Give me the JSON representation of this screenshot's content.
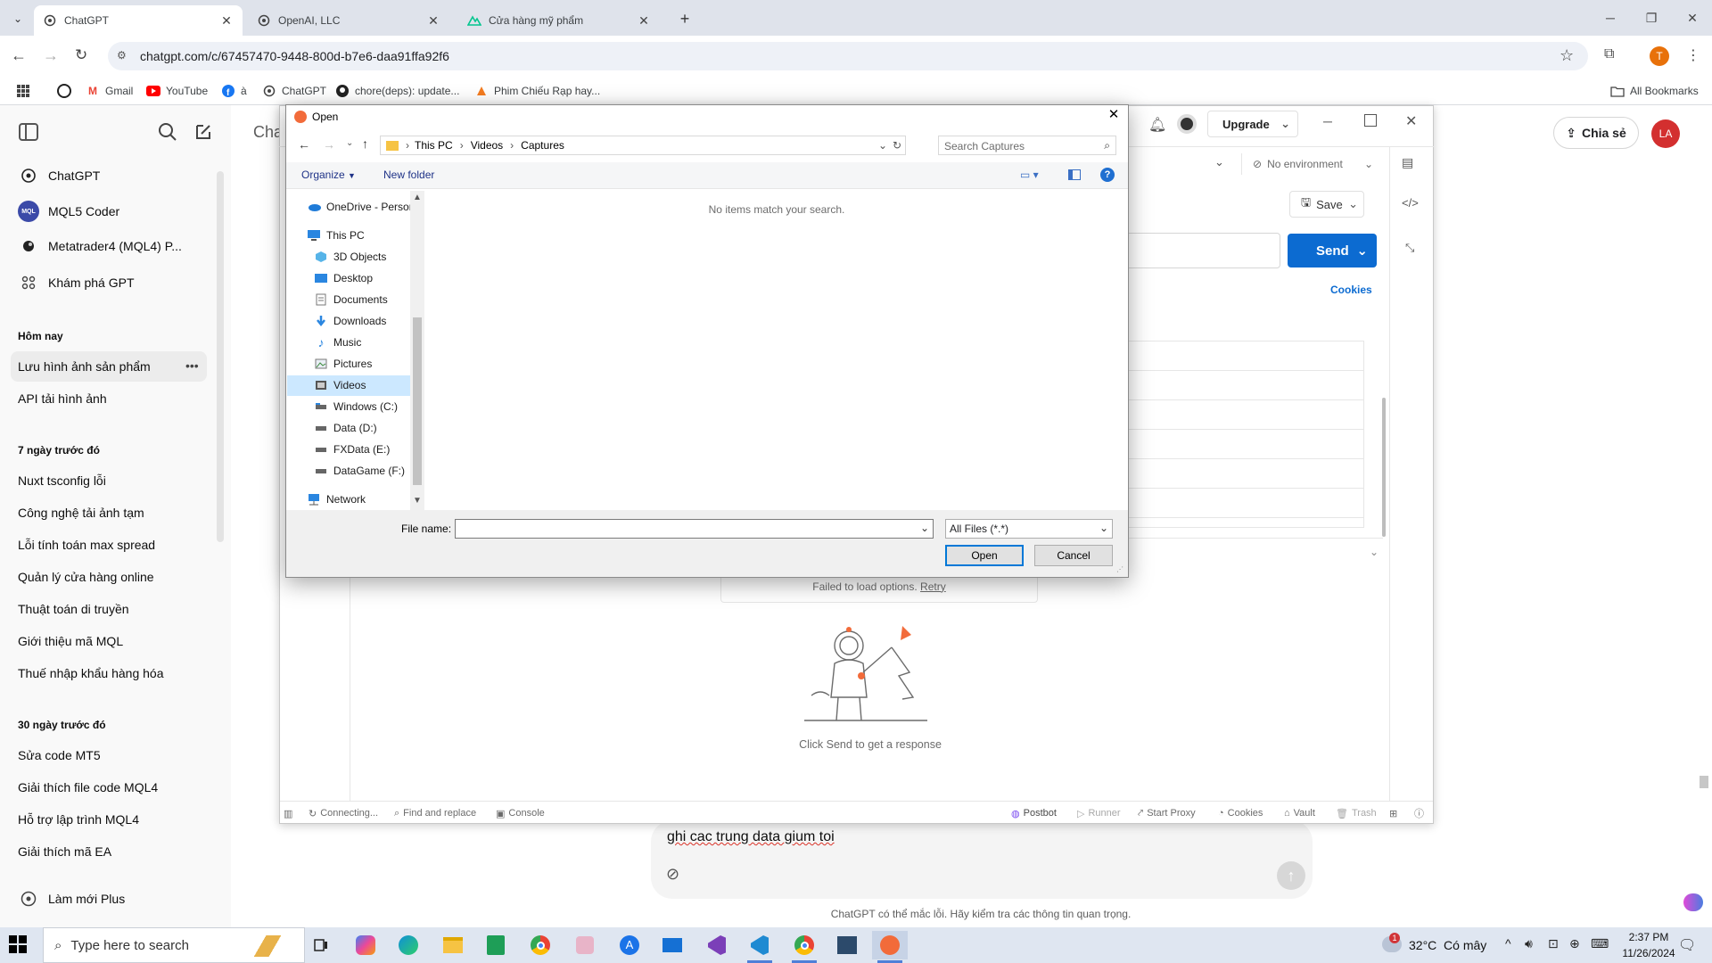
{
  "browser": {
    "tabs": [
      {
        "title": "ChatGPT",
        "active": true
      },
      {
        "title": "OpenAI, LLC",
        "active": false
      },
      {
        "title": "Cửa hàng mỹ phẩm",
        "active": false
      }
    ],
    "url": "chatgpt.com/c/67457470-9448-800d-b7e6-daa91ffa92f6",
    "profile_initial": "T",
    "bookmarks": [
      {
        "label": "Gmail",
        "icon": "gmail-icon"
      },
      {
        "label": "YouTube",
        "icon": "youtube-icon"
      },
      {
        "label": "à",
        "icon": "facebook-icon"
      },
      {
        "label": "ChatGPT",
        "icon": "chatgpt-icon"
      },
      {
        "label": "chore(deps): update...",
        "icon": "github-icon"
      },
      {
        "label": "Phim Chiếu Rạp hay...",
        "icon": "movie-icon"
      }
    ],
    "all_bookmarks": "All Bookmarks"
  },
  "chatgpt": {
    "header_title": "Cha",
    "share_label": "Chia sẻ",
    "avatar": "LA",
    "nav": [
      {
        "label": "ChatGPT",
        "icon": "chatgpt-icon"
      },
      {
        "label": "MQL5 Coder",
        "icon": "mql5-icon"
      },
      {
        "label": "Metatrader4 (MQL4) P...",
        "icon": "metatrader-icon"
      },
      {
        "label": "Khám phá GPT",
        "icon": "grid-icon"
      }
    ],
    "sections": [
      {
        "heading": "Hôm nay",
        "items": [
          "Lưu hình ảnh sản phẩm",
          "API tải hình ảnh"
        ]
      },
      {
        "heading": "7 ngày trước đó",
        "items": [
          "Nuxt tsconfig lỗi",
          "Công nghệ tải ảnh tạm",
          "Lỗi tính toán max spread",
          "Quản lý cửa hàng online",
          "Thuật toán di truyền",
          "Giới thiệu mã MQL",
          "Thuế nhập khẩu hàng hóa"
        ]
      },
      {
        "heading": "30 ngày trước đó",
        "items": [
          "Sửa code MT5",
          "Giải thích file code MQL4",
          "Hỗ trợ lập trình MQL4",
          "Giải thích mã EA"
        ]
      }
    ],
    "upgrade_label": "Làm mới Plus",
    "composer_text": "ghi cac trung data gium toi",
    "disclaimer": "ChatGPT có thể mắc lỗi. Hãy kiểm tra các thông tin quan trọng."
  },
  "postman": {
    "upgrade_label": "Upgrade",
    "environment": "No environment",
    "save_label": "Save",
    "send_label": "Send",
    "cookies_link": "Cookies",
    "failed_text": "Failed to load options.",
    "retry_label": "Retry",
    "empty_caption": "Click Send to get a response",
    "status_left": [
      "Connecting...",
      "Find and replace",
      "Console"
    ],
    "status_right": [
      "Postbot",
      "Runner",
      "Start Proxy",
      "Cookies",
      "Vault",
      "Trash"
    ]
  },
  "dialog": {
    "title": "Open",
    "breadcrumb": [
      "This PC",
      "Videos",
      "Captures"
    ],
    "search_placeholder": "Search Captures",
    "organize_label": "Organize",
    "new_folder_label": "New folder",
    "empty_message": "No items match your search.",
    "tree": [
      {
        "label": "OneDrive - Persor",
        "icon": "onedrive-icon"
      },
      {
        "label": "This PC",
        "icon": "computer-icon"
      },
      {
        "label": "3D Objects",
        "icon": "3d-objects-icon"
      },
      {
        "label": "Desktop",
        "icon": "desktop-icon"
      },
      {
        "label": "Documents",
        "icon": "documents-icon"
      },
      {
        "label": "Downloads",
        "icon": "downloads-icon"
      },
      {
        "label": "Music",
        "icon": "music-icon"
      },
      {
        "label": "Pictures",
        "icon": "pictures-icon"
      },
      {
        "label": "Videos",
        "icon": "videos-icon",
        "selected": true
      },
      {
        "label": "Windows (C:)",
        "icon": "drive-icon"
      },
      {
        "label": "Data (D:)",
        "icon": "drive-icon"
      },
      {
        "label": "FXData (E:)",
        "icon": "drive-icon"
      },
      {
        "label": "DataGame (F:)",
        "icon": "drive-icon"
      },
      {
        "label": "Network",
        "icon": "network-icon"
      }
    ],
    "filename_label": "File name:",
    "filename_value": "",
    "filetype": "All Files (*.*)",
    "open_label": "Open",
    "cancel_label": "Cancel"
  },
  "taskbar": {
    "search_placeholder": "Type here to search",
    "weather": "32°C  Có mây",
    "time": "2:37 PM",
    "date": "11/26/2024",
    "notification_count": "1"
  }
}
